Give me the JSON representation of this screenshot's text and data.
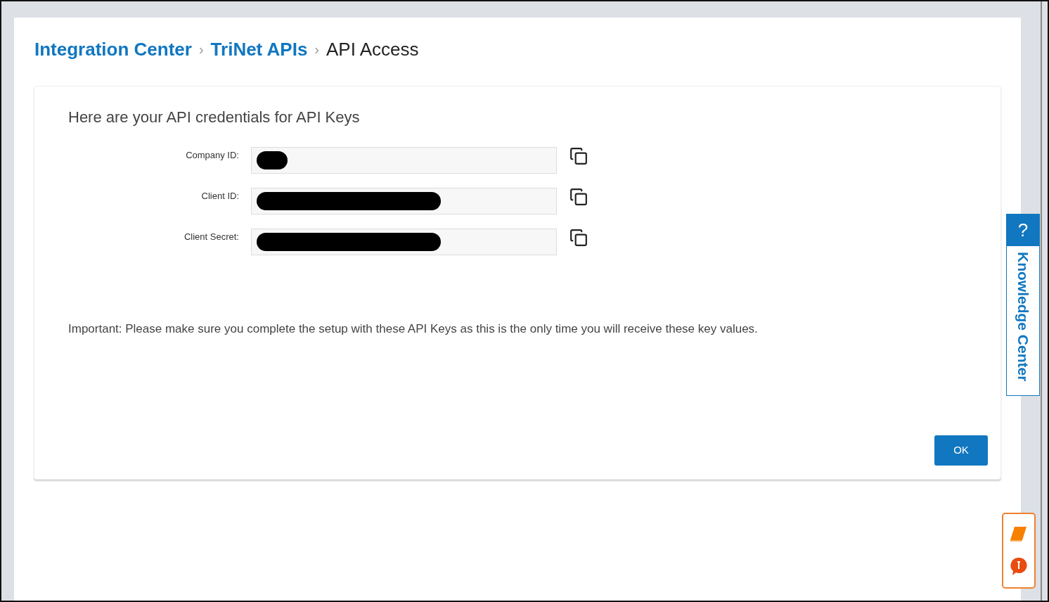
{
  "breadcrumb": {
    "separator": "›",
    "items": [
      {
        "label": "Integration Center",
        "kind": "link"
      },
      {
        "label": "TriNet APIs",
        "kind": "link"
      },
      {
        "label": "API Access",
        "kind": "current"
      }
    ]
  },
  "card": {
    "title": "Here are your API credentials for API Keys",
    "fields": [
      {
        "label": "Company ID:",
        "kind": "short"
      },
      {
        "label": "Client ID:",
        "kind": "long"
      },
      {
        "label": "Client Secret:",
        "kind": "long"
      }
    ],
    "notice": "Important: Please make sure you complete the setup with these API Keys as this is the only time you will receive these key values.",
    "ok_button": "OK"
  },
  "knowledge_tab": {
    "icon_text": "?",
    "label": "Knowledge Center"
  }
}
